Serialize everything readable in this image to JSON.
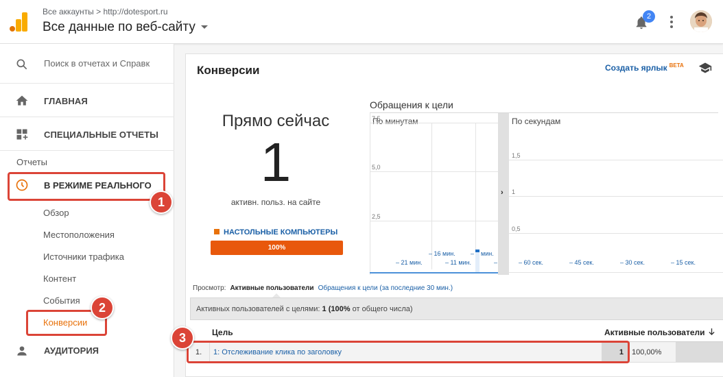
{
  "header": {
    "breadcrumb_accounts": "Все аккаунты",
    "breadcrumb_sep": ">",
    "breadcrumb_site": "http://dotesport.ru",
    "property": "Все данные по веб-сайту",
    "notification_count": "2",
    "logo_icon": "analytics-logo-icon",
    "bell_icon": "bell-icon",
    "menu_icon": "more-vert-icon"
  },
  "sidebar": {
    "search_placeholder": "Поиск в отчетах и Справк",
    "home": "ГЛАВНАЯ",
    "custom_reports": "СПЕЦИАЛЬНЫЕ ОТЧЕТЫ",
    "reports_label": "Отчеты",
    "realtime": "В РЕЖИМЕ РЕАЛЬНОГО",
    "realtime_items": [
      "Обзор",
      "Местоположения",
      "Источники трафика",
      "Контент",
      "События",
      "Конверсии"
    ],
    "active_item": "Конверсии",
    "audience": "АУДИТОРИЯ"
  },
  "annotations": [
    "1",
    "2",
    "3"
  ],
  "card": {
    "title": "Конверсии",
    "shortcut": "Создать ярлык",
    "shortcut_badge": "BETA",
    "now_title": "Прямо сейчас",
    "now_value": "1",
    "now_subtitle": "активн. польз. на сайте",
    "device_label": "НАСТОЛЬНЫЕ КОМПЬЮТЕРЫ",
    "device_pct": "100%",
    "chart_title": "Обращения к цели",
    "view_label": "Просмотр:",
    "view_active": "Активные пользователи",
    "view_link": "Обращения к цели (за последние 30 мин.)",
    "summary_label": "Активных пользователей с целями:",
    "summary_value": "1",
    "summary_pct": "(100%",
    "summary_tail": "от общего числа)",
    "col_goal": "Цель",
    "col_users": "Активные пользователи",
    "rows": [
      {
        "idx": "1.",
        "goal": "1: Отслеживание клика по заголовку",
        "value": "1",
        "pct": "100,00%"
      }
    ]
  },
  "chart_data": [
    {
      "type": "bar",
      "title": "По минутам",
      "y_ticks": [
        "7,5",
        "5,0",
        "2,5"
      ],
      "x_ticks": [
        "– 21 мин.",
        "– 16 мин.",
        "– 11 мин.",
        "– 6 мин.",
        "–"
      ],
      "ylim": [
        0,
        7.5
      ],
      "categories": [
        "-6 мин."
      ],
      "values": [
        1
      ],
      "color": "#4a90d9"
    },
    {
      "type": "bar",
      "title": "По секундам",
      "y_ticks": [
        "1,5",
        "1",
        "0,5"
      ],
      "x_ticks": [
        "– 60 сек.",
        "– 45 сек.",
        "– 30 сек.",
        "– 15 сек."
      ],
      "ylim": [
        0,
        2
      ],
      "values": []
    }
  ]
}
